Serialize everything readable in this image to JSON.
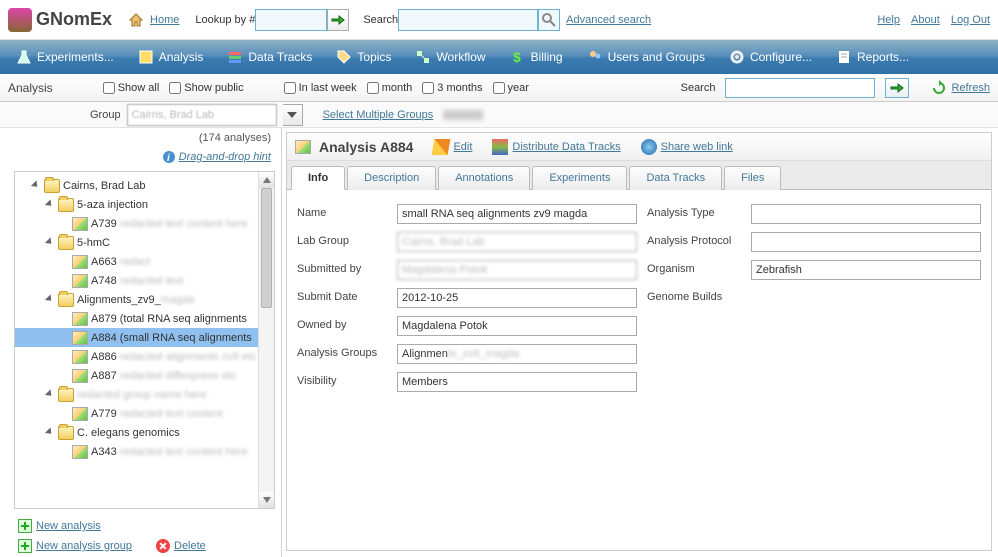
{
  "app": {
    "name": "GNomEx"
  },
  "topbar": {
    "home": "Home",
    "lookup_label": "Lookup by #",
    "search_label": "Search",
    "advanced": "Advanced search",
    "help": "Help",
    "about": "About",
    "logout": "Log Out"
  },
  "nav": {
    "experiments": "Experiments...",
    "analysis": "Analysis",
    "datatracks": "Data Tracks",
    "topics": "Topics",
    "workflow": "Workflow",
    "billing": "Billing",
    "users": "Users and Groups",
    "configure": "Configure...",
    "reports": "Reports..."
  },
  "filter": {
    "panel_title": "Analysis",
    "show_all": "Show all",
    "show_public": "Show public",
    "last_week": "In last week",
    "month": "month",
    "three_months": "3 months",
    "year": "year",
    "search": "Search",
    "refresh": "Refresh"
  },
  "group": {
    "label": "Group",
    "value": "Cairns, Brad Lab",
    "select_multiple": "Select Multiple Groups",
    "count_text": "(174 analyses)",
    "hint": "Drag-and-drop hint"
  },
  "tree": {
    "root": "Cairns, Brad Lab",
    "n1": "5-aza injection",
    "n1a": "A739",
    "n2": "5-hmC",
    "n2a": "A663",
    "n2b": "A748",
    "n3": "Alignments_zv9_",
    "n3a": "A879 (total RNA seq alignments",
    "n3b": "A884 (small RNA seq alignments",
    "n3c": "A886",
    "n3d": "A887",
    "n4": "",
    "n4a": "A779",
    "n5": "C. elegans genomics",
    "n5a": "A343"
  },
  "actions": {
    "new_analysis": "New analysis",
    "new_group": "New analysis group",
    "delete": "Delete"
  },
  "detail": {
    "title": "Analysis A884",
    "edit": "Edit",
    "distribute": "Distribute Data Tracks",
    "share": "Share web link",
    "tabs": {
      "info": "Info",
      "description": "Description",
      "annotations": "Annotations",
      "experiments": "Experiments",
      "datatracks": "Data Tracks",
      "files": "Files"
    },
    "fields": {
      "name_lbl": "Name",
      "name_val": "small RNA seq alignments zv9 magda",
      "labgroup_lbl": "Lab Group",
      "labgroup_val": "Cairns, Brad Lab",
      "submittedby_lbl": "Submitted by",
      "submittedby_val": "Magdalena Potok",
      "submitdate_lbl": "Submit Date",
      "submitdate_val": "2012-10-25",
      "ownedby_lbl": "Owned by",
      "ownedby_val": "Magdalena Potok",
      "groups_lbl": "Analysis Groups",
      "groups_val": "Alignments_zv9_magda",
      "visibility_lbl": "Visibility",
      "visibility_val": "Members",
      "type_lbl": "Analysis Type",
      "type_val": "",
      "protocol_lbl": "Analysis Protocol",
      "protocol_val": "",
      "organism_lbl": "Organism",
      "organism_val": "Zebrafish",
      "builds_lbl": "Genome Builds",
      "builds_val": ""
    }
  }
}
